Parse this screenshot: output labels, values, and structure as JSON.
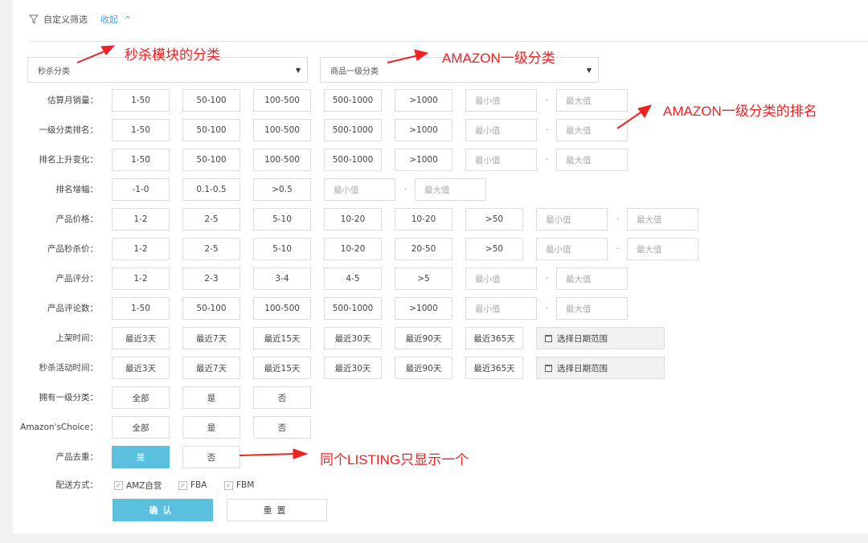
{
  "header": {
    "filter_label": "自定义筛选",
    "collapse_label": "收起",
    "collapse_icon": "^"
  },
  "selects": {
    "flash_category": "秒杀分类",
    "product_category": "商品一级分类",
    "caret": "▼"
  },
  "rows": [
    {
      "label": "估算月销量：",
      "options": [
        "1-50",
        "50-100",
        "100-500",
        "500-1000",
        ">1000"
      ],
      "min": "最小值",
      "max": "最大值"
    },
    {
      "label": "一级分类排名：",
      "options": [
        "1-50",
        "50-100",
        "100-500",
        "500-1000",
        ">1000"
      ],
      "min": "最小值",
      "max": "最大值"
    },
    {
      "label": "排名上升变化：",
      "options": [
        "1-50",
        "50-100",
        "100-500",
        "500-1000",
        ">1000"
      ],
      "min": "最小值",
      "max": "最大值"
    },
    {
      "label": "排名增幅：",
      "options": [
        "-1-0",
        "0.1-0.5",
        ">0.5"
      ],
      "min": "最小值",
      "max": "最大值"
    },
    {
      "label": "产品价格：",
      "options": [
        "1-2",
        "2-5",
        "5-10",
        "10-20",
        "10-20",
        ">50"
      ],
      "min": "最小值",
      "max": "最大值"
    },
    {
      "label": "产品秒杀价：",
      "options": [
        "1-2",
        "2-5",
        "5-10",
        "10-20",
        "20-50",
        ">50"
      ],
      "min": "最小值",
      "max": "最大值"
    },
    {
      "label": "产品评分：",
      "options": [
        "1-2",
        "2-3",
        "3-4",
        "4-5",
        ">5"
      ],
      "min": "最小值",
      "max": "最大值"
    },
    {
      "label": "产品评论数：",
      "options": [
        "1-50",
        "50-100",
        "100-500",
        "500-1000",
        ">1000"
      ],
      "min": "最小值",
      "max": "最大值"
    },
    {
      "label": "上架时间：",
      "options": [
        "最近3天",
        "最近7天",
        "最近15天",
        "最近30天",
        "最近90天",
        "最近365天"
      ],
      "date_range": "选择日期范围"
    },
    {
      "label": "秒杀活动时间：",
      "options": [
        "最近3天",
        "最近7天",
        "最近15天",
        "最近30天",
        "最近90天",
        "最近365天"
      ],
      "date_range": "选择日期范围"
    },
    {
      "label": "拥有一级分类：",
      "options": [
        "全部",
        "是",
        "否"
      ]
    },
    {
      "label": "Amazon'sChoice：",
      "options": [
        "全部",
        "是",
        "否"
      ]
    },
    {
      "label": "产品去重：",
      "options": [
        "是",
        "否"
      ],
      "active_index": 0
    }
  ],
  "delivery": {
    "label": "配送方式：",
    "options": [
      {
        "label": "AMZ自营",
        "checked": true
      },
      {
        "label": "FBA",
        "checked": true
      },
      {
        "label": "FBM",
        "checked": true
      }
    ]
  },
  "buttons": {
    "confirm": "确认",
    "reset": "重置"
  },
  "annotations": {
    "flash_category": "秒杀模块的分类",
    "amazon_category": "AMAZON一级分类",
    "amazon_rank": "AMAZON一级分类的排名",
    "dedupe": "同个LISTING只显示一个"
  },
  "colors": {
    "accent": "#5bc0de",
    "annotation": "#ee2222",
    "link": "#4aa3d8"
  }
}
